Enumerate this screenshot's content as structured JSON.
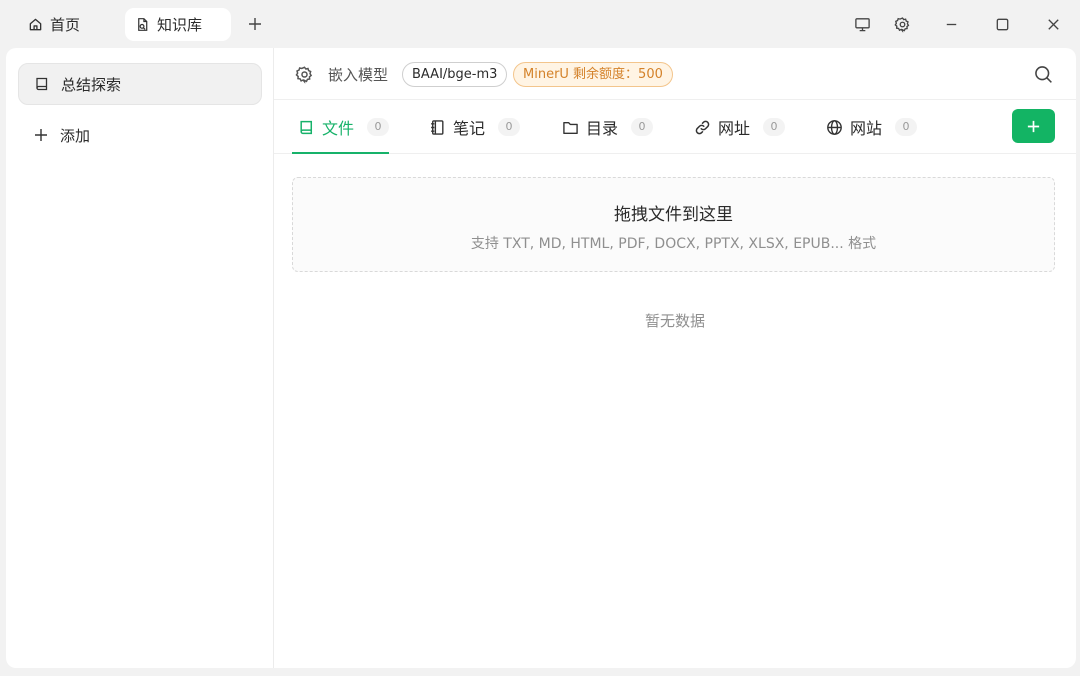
{
  "titlebar": {
    "tabs": [
      {
        "label": "首页",
        "icon": "home-icon"
      },
      {
        "label": "知识库",
        "icon": "knowledge-doc-icon"
      }
    ],
    "window_controls": [
      "monitor-icon",
      "gear-icon",
      "minimize-icon",
      "maximize-icon",
      "close-icon"
    ]
  },
  "sidebar": {
    "items": [
      {
        "label": "总结探索",
        "icon": "book-icon",
        "active": true
      },
      {
        "label": "添加",
        "icon": "plus-icon"
      }
    ]
  },
  "topbar": {
    "embed_label": "嵌入模型",
    "model": "BAAI/bge-m3",
    "miner_quota": "MinerU 剩余额度：500"
  },
  "tabs": [
    {
      "label": "文件",
      "count": "0",
      "icon": "book-icon",
      "active": true
    },
    {
      "label": "笔记",
      "count": "0",
      "icon": "notebook-icon"
    },
    {
      "label": "目录",
      "count": "0",
      "icon": "folder-icon"
    },
    {
      "label": "网址",
      "count": "0",
      "icon": "link-icon"
    },
    {
      "label": "网站",
      "count": "0",
      "icon": "globe-icon"
    }
  ],
  "dropzone": {
    "title": "拖拽文件到这里",
    "subtitle": "支持 TXT, MD, HTML, PDF, DOCX, PPTX, XLSX, EPUB... 格式"
  },
  "empty_text": "暂无数据",
  "colors": {
    "accent": "#17b26a",
    "quota_text": "#d4822a",
    "quota_bg": "#fff4e4"
  }
}
